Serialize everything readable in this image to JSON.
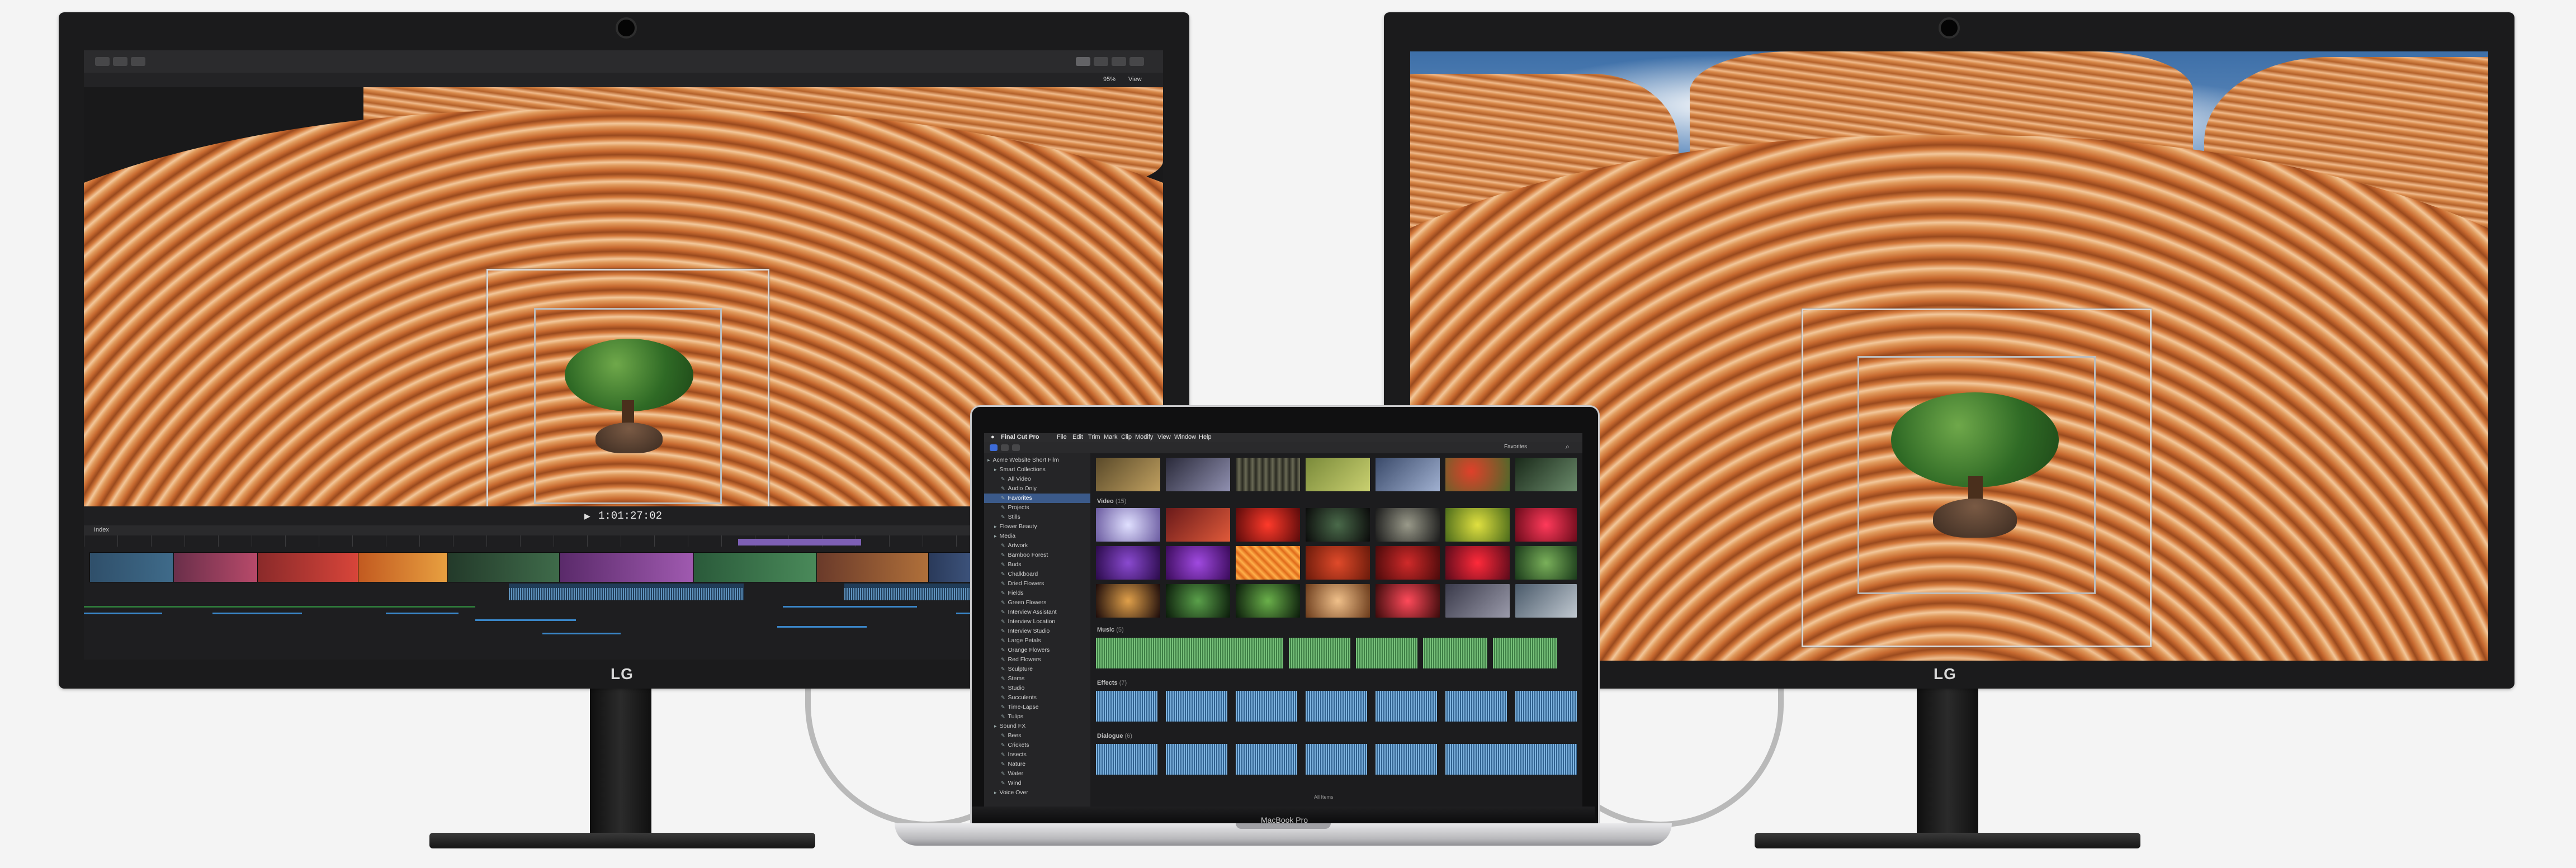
{
  "left_monitor": {
    "brand": "LG",
    "fcp": {
      "timecode": "1:01:27:02",
      "toolbar_left": "Index",
      "zoom": "95%",
      "view": "View"
    }
  },
  "right_monitor": {
    "brand": "LG"
  },
  "laptop": {
    "label": "MacBook Pro",
    "menubar": {
      "app": "Final Cut Pro",
      "items": [
        "File",
        "Edit",
        "Trim",
        "Mark",
        "Clip",
        "Modify",
        "View",
        "Window",
        "Help"
      ]
    },
    "toolbar": {
      "filter": "Favorites"
    },
    "library_title": "Acme Website Short Film",
    "sidebar": [
      {
        "label": "Acme Website Short Film",
        "indent": 0
      },
      {
        "label": "Smart Collections",
        "indent": 1
      },
      {
        "label": "All Video",
        "indent": 2
      },
      {
        "label": "Audio Only",
        "indent": 2
      },
      {
        "label": "Favorites",
        "indent": 2
      },
      {
        "label": "Projects",
        "indent": 2
      },
      {
        "label": "Stills",
        "indent": 2
      },
      {
        "label": "Flower Beauty",
        "indent": 1
      },
      {
        "label": "Media",
        "indent": 1
      },
      {
        "label": "Artwork",
        "indent": 2
      },
      {
        "label": "Bamboo Forest",
        "indent": 2
      },
      {
        "label": "Buds",
        "indent": 2
      },
      {
        "label": "Chalkboard",
        "indent": 2
      },
      {
        "label": "Dried Flowers",
        "indent": 2
      },
      {
        "label": "Fields",
        "indent": 2
      },
      {
        "label": "Green Flowers",
        "indent": 2
      },
      {
        "label": "Interview Assistant",
        "indent": 2
      },
      {
        "label": "Interview Location",
        "indent": 2
      },
      {
        "label": "Interview Studio",
        "indent": 2
      },
      {
        "label": "Large Petals",
        "indent": 2
      },
      {
        "label": "Orange Flowers",
        "indent": 2
      },
      {
        "label": "Red Flowers",
        "indent": 2
      },
      {
        "label": "Sculpture",
        "indent": 2
      },
      {
        "label": "Stems",
        "indent": 2
      },
      {
        "label": "Studio",
        "indent": 2
      },
      {
        "label": "Succulents",
        "indent": 2
      },
      {
        "label": "Time-Lapse",
        "indent": 2
      },
      {
        "label": "Tulips",
        "indent": 2
      },
      {
        "label": "Sound FX",
        "indent": 1
      },
      {
        "label": "Bees",
        "indent": 2
      },
      {
        "label": "Crickets",
        "indent": 2
      },
      {
        "label": "Insects",
        "indent": 2
      },
      {
        "label": "Nature",
        "indent": 2
      },
      {
        "label": "Water",
        "indent": 2
      },
      {
        "label": "Wind",
        "indent": 2
      },
      {
        "label": "Voice Over",
        "indent": 1
      }
    ],
    "sections": {
      "video": "Video",
      "video_count": "(15)",
      "music": "Music",
      "music_count": "(5)",
      "effects": "Effects",
      "effects_count": "(7)",
      "dialogue": "Dialogue",
      "dialogue_count": "(6)"
    },
    "footer": "All Items"
  },
  "colors": {
    "screen_bg": "#1c1c1e",
    "bezel": "#1b1b1c",
    "accent_blue": "#3b5a8a",
    "music_green": "#77c07a",
    "audio_blue": "#7fb4e0"
  }
}
